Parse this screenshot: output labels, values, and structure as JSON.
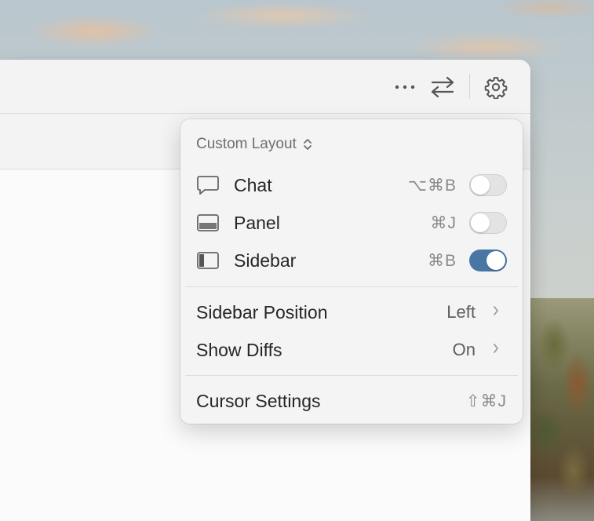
{
  "menu": {
    "header": "Custom Layout",
    "items": [
      {
        "label": "Chat",
        "shortcut": "⌥⌘B",
        "toggle": "off",
        "icon": "chat-bubble-icon"
      },
      {
        "label": "Panel",
        "shortcut": "⌘J",
        "toggle": "off",
        "icon": "panel-icon"
      },
      {
        "label": "Sidebar",
        "shortcut": "⌘B",
        "toggle": "on",
        "icon": "sidebar-icon"
      }
    ],
    "settings": [
      {
        "label": "Sidebar Position",
        "value": "Left"
      },
      {
        "label": "Show Diffs",
        "value": "On"
      }
    ],
    "footer": {
      "label": "Cursor Settings",
      "shortcut": "⇧⌘J"
    }
  },
  "colors": {
    "accent": "#4a76a6",
    "menu_bg": "#f4f4f4",
    "window_bg": "#f3f3f3"
  },
  "toolbar": {
    "icons": [
      "more-icon",
      "swap-icon",
      "gear-icon"
    ]
  }
}
